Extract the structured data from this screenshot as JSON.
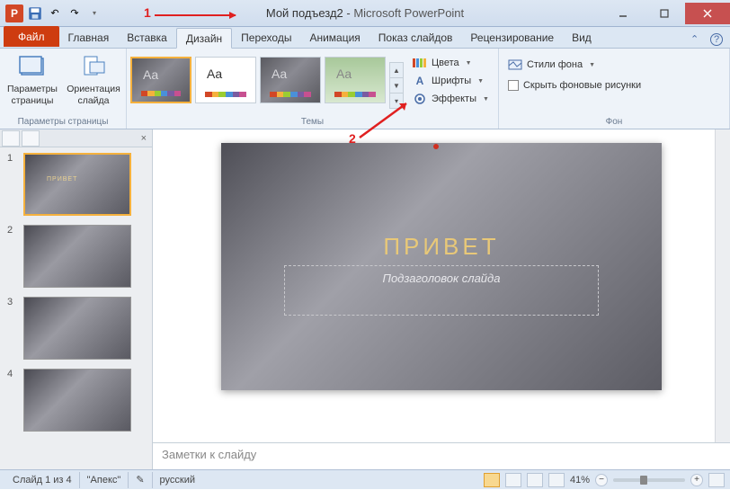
{
  "title": {
    "doc": "Мой подъезд2",
    "sep": " - ",
    "app": "Microsoft PowerPoint"
  },
  "tabs": {
    "file": "Файл",
    "list": [
      "Главная",
      "Вставка",
      "Дизайн",
      "Переходы",
      "Анимация",
      "Показ слайдов",
      "Рецензирование",
      "Вид"
    ],
    "active_index": 2
  },
  "ribbon": {
    "page_setup": {
      "params": "Параметры страницы",
      "orient": "Ориентация слайда",
      "group_label": "Параметры страницы"
    },
    "themes": {
      "group_label": "Темы",
      "colors": "Цвета",
      "fonts": "Шрифты",
      "effects": "Эффекты"
    },
    "background": {
      "group_label": "Фон",
      "styles": "Стили фона",
      "hide": "Скрыть фоновые рисунки"
    }
  },
  "slide": {
    "title": "ПРИВЕТ",
    "subtitle": "Подзаголовок слайда"
  },
  "thumbs": {
    "title": "ПРИВЕТ",
    "count": 4,
    "selected": 1
  },
  "notes": {
    "placeholder": "Заметки к слайду"
  },
  "status": {
    "slide_info": "Слайд 1 из 4",
    "theme": "\"Апекс\"",
    "lang": "русский",
    "zoom": "41%"
  },
  "annotations": {
    "one": "1",
    "two": "2"
  },
  "theme_colorbar": [
    "#d24726",
    "#f5b13d",
    "#9acd32",
    "#4a90d9",
    "#7a5ca0",
    "#c75090"
  ]
}
